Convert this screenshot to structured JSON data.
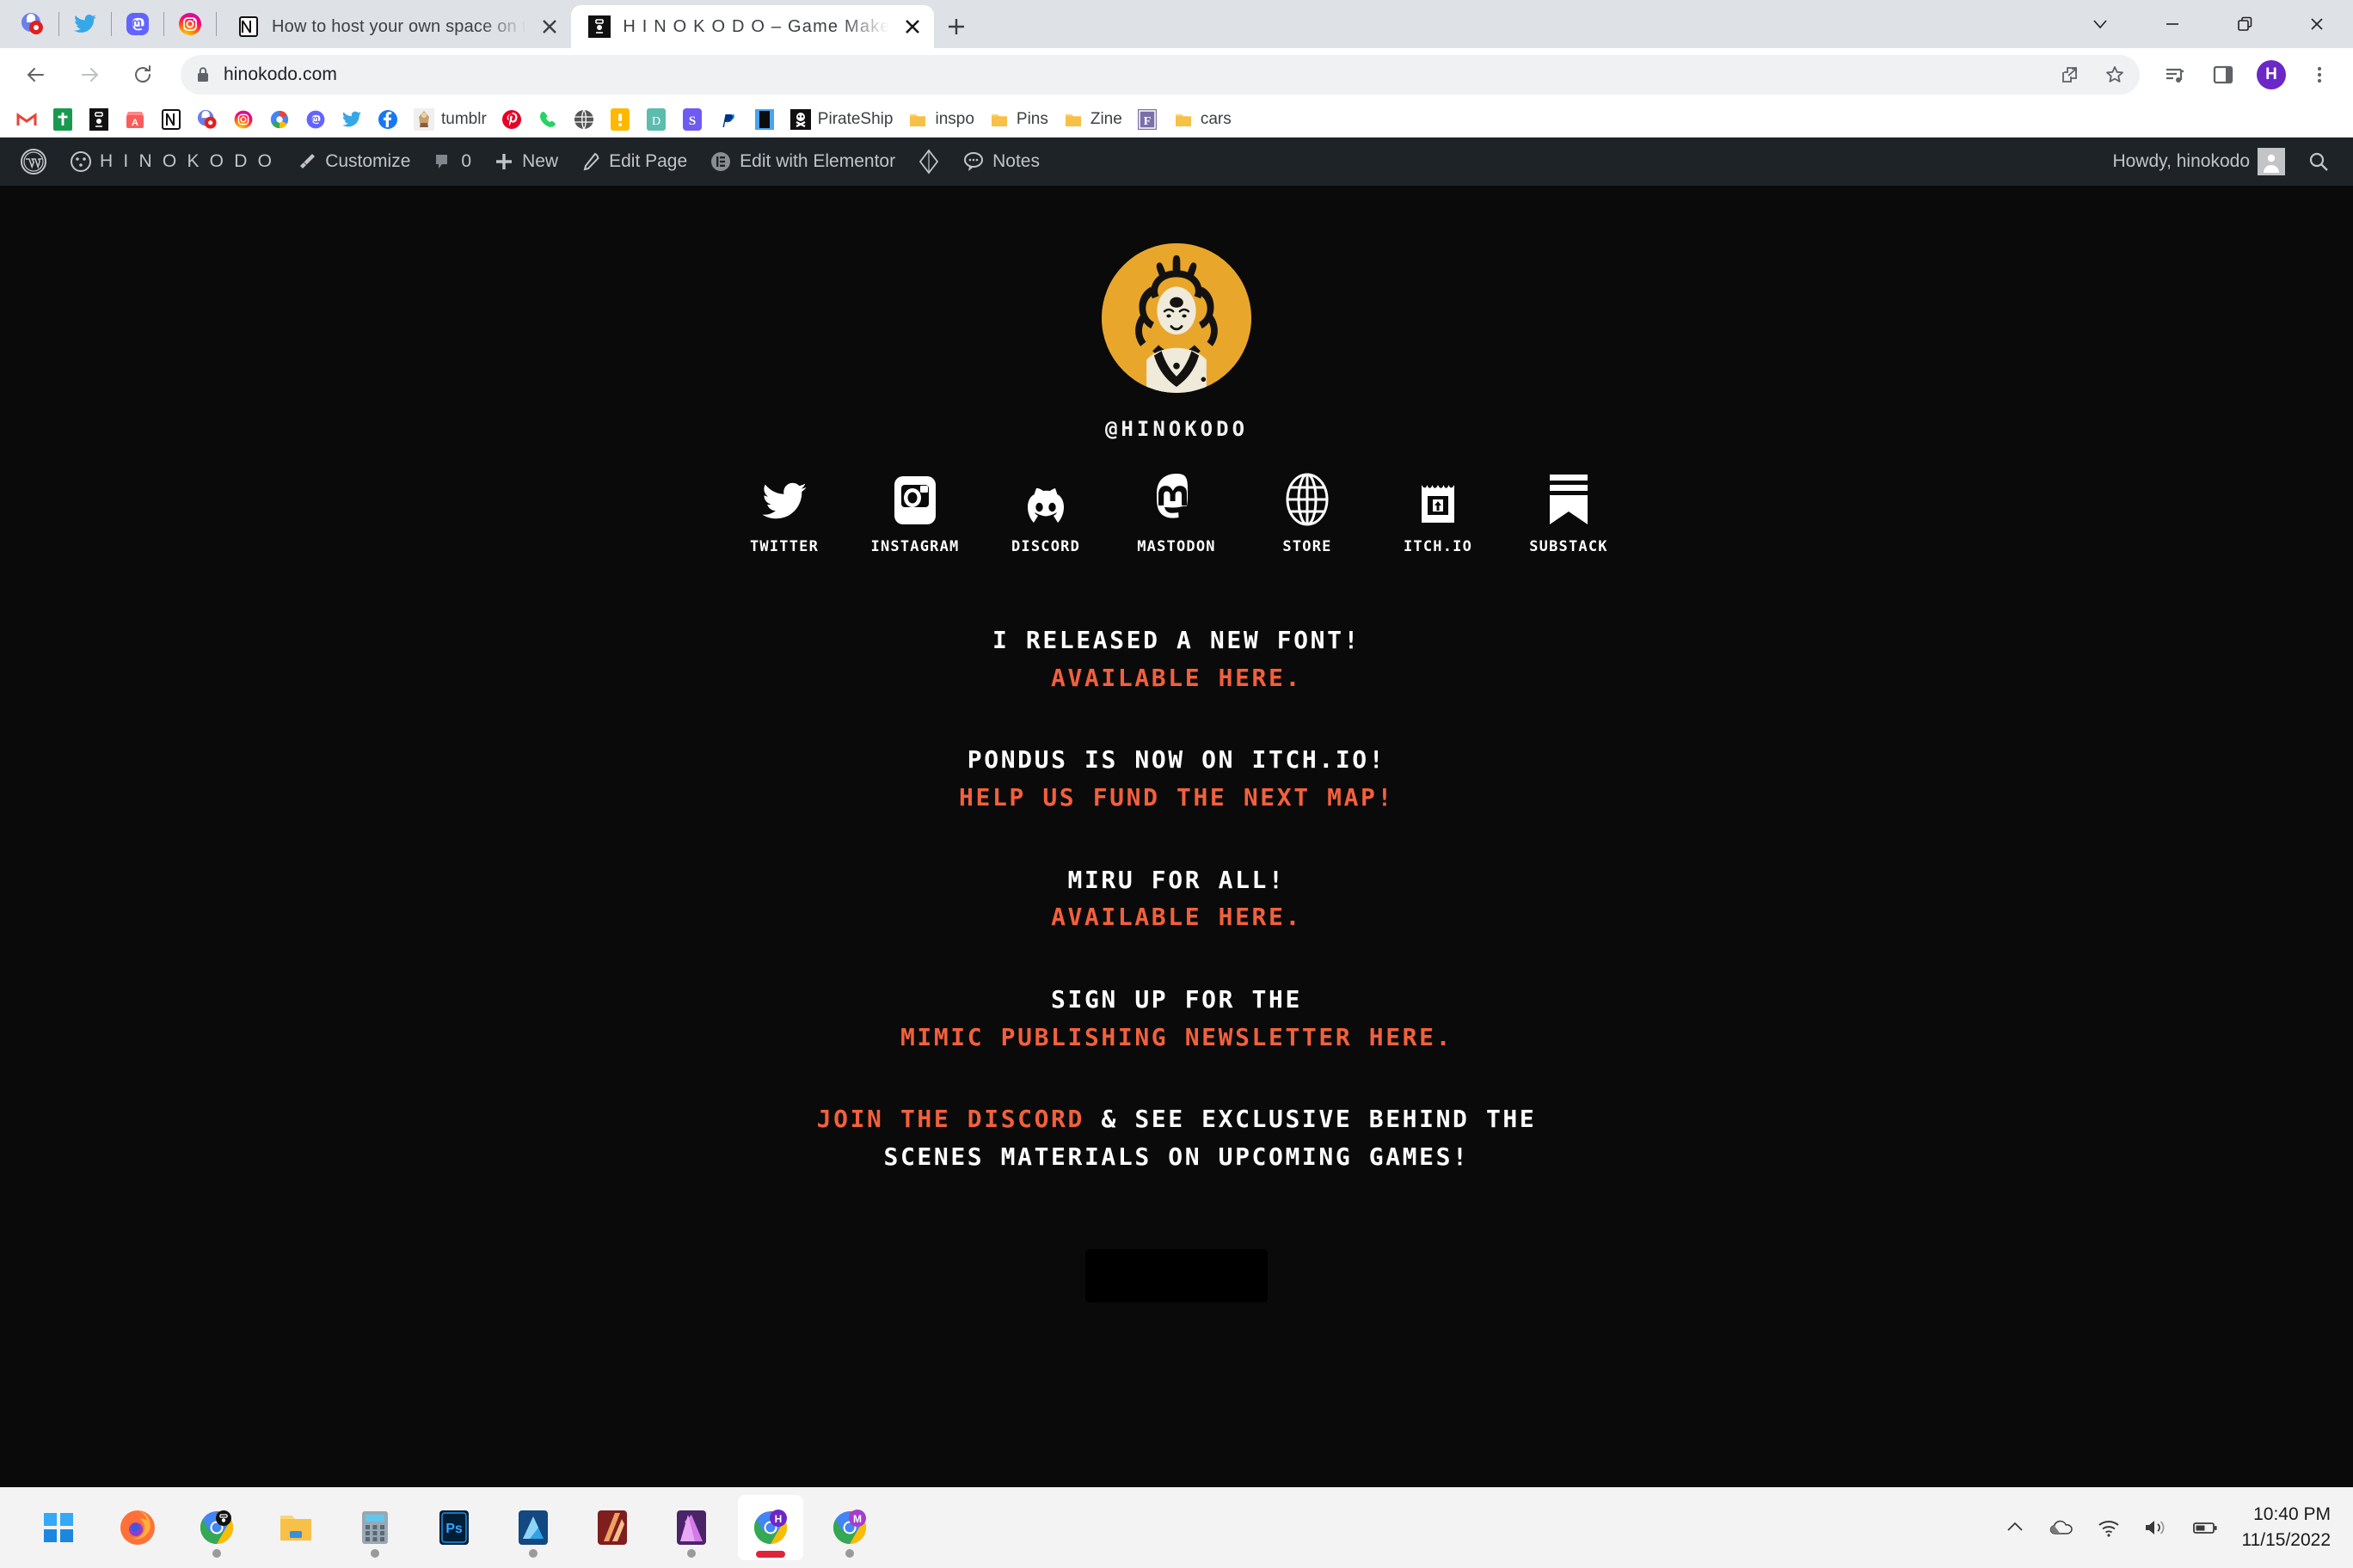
{
  "browser": {
    "pinned_tabs": [
      {
        "name": "google-photos-pinned-tab",
        "icon": "google-photos-icon"
      },
      {
        "name": "twitter-pinned-tab",
        "icon": "twitter-icon"
      },
      {
        "name": "mastodon-pinned-tab",
        "icon": "mastodon-icon"
      },
      {
        "name": "instagram-pinned-tab",
        "icon": "instagram-icon"
      }
    ],
    "tabs": [
      {
        "title": "How to host your own space on t",
        "favicon": "notion-icon",
        "active": false
      },
      {
        "title": "H I N O K O D O – Game Maker &",
        "favicon": "hinokodo-icon",
        "active": true
      }
    ],
    "new_tab_label": "+",
    "window_controls": {
      "minimize_to_tray": "v",
      "minimize": "—",
      "restore": "❐",
      "close": "✕"
    },
    "nav": {
      "back": "←",
      "forward": "→",
      "reload": "⟳"
    },
    "omnibox": {
      "url": "hinokodo.com",
      "lock_icon": "lock-icon",
      "share_icon": "share-icon",
      "bookmark_icon": "star-icon"
    },
    "toolbar_icons": [
      "media-control-icon",
      "side-panel-icon",
      "profile-avatar",
      "three-dot-menu-icon"
    ],
    "profile_initial": "H",
    "bookmarks": [
      {
        "label": "",
        "icon": "gmail-icon"
      },
      {
        "label": "",
        "icon": "bible-icon"
      },
      {
        "label": "",
        "icon": "hinokodo-icon"
      },
      {
        "label": "",
        "icon": "storefront-icon"
      },
      {
        "label": "",
        "icon": "notion-icon"
      },
      {
        "label": "",
        "icon": "google-photos-icon"
      },
      {
        "label": "",
        "icon": "instagram-icon"
      },
      {
        "label": "",
        "icon": "google-photos-alt-icon"
      },
      {
        "label": "",
        "icon": "mastodon-icon"
      },
      {
        "label": "",
        "icon": "twitter-icon"
      },
      {
        "label": "",
        "icon": "facebook-icon"
      },
      {
        "label": "tumblr",
        "icon": "tumblr-icon"
      },
      {
        "label": "",
        "icon": "pinterest-icon"
      },
      {
        "label": "",
        "icon": "phone-icon"
      },
      {
        "label": "",
        "icon": "globe-icon"
      },
      {
        "label": "",
        "icon": "yellow-app-icon"
      },
      {
        "label": "",
        "icon": "teal-d-icon"
      },
      {
        "label": "",
        "icon": "substack-s-icon"
      },
      {
        "label": "",
        "icon": "paypal-icon"
      },
      {
        "label": "",
        "icon": "blue-square-icon"
      },
      {
        "label": "PirateShip",
        "icon": "pirateship-icon"
      },
      {
        "label": "inspo",
        "icon": "folder-icon"
      },
      {
        "label": "Pins",
        "icon": "folder-icon"
      },
      {
        "label": "Zine",
        "icon": "folder-icon"
      },
      {
        "label": "",
        "icon": "figma-f-icon"
      },
      {
        "label": "cars",
        "icon": "folder-icon"
      }
    ]
  },
  "wp_admin_bar": {
    "logo": "wordpress-icon",
    "site_name": "H I N O K O D O",
    "items": [
      {
        "label": "Customize",
        "icon": "paintbrush-icon"
      },
      {
        "label": "0",
        "icon": "comment-bubble-icon"
      },
      {
        "label": "New",
        "icon": "plus-icon"
      },
      {
        "label": "Edit Page",
        "icon": "pencil-icon"
      },
      {
        "label": "Edit with Elementor",
        "icon": "elementor-icon"
      },
      {
        "label": "",
        "icon": "diamond-icon"
      },
      {
        "label": "Notes",
        "icon": "notes-bubble-icon"
      }
    ],
    "greeting": "Howdy, hinokodo",
    "avatar": "user-avatar",
    "search": "search-icon"
  },
  "site": {
    "avatar_alt": "hinokodo-illustrated-avatar",
    "avatar_bg": "#E8A72B",
    "handle": "@HINOKODO",
    "link_color": "#F2603C",
    "text_color": "#FFFFFF",
    "background": "#0A0A0A",
    "socials": [
      {
        "label": "TWITTER",
        "icon": "twitter-icon"
      },
      {
        "label": "INSTAGRAM",
        "icon": "instagram-icon"
      },
      {
        "label": "DISCORD",
        "icon": "discord-icon"
      },
      {
        "label": "MASTODON",
        "icon": "mastodon-icon"
      },
      {
        "label": "STORE",
        "icon": "globe-icon"
      },
      {
        "label": "ITCH.IO",
        "icon": "itchio-icon"
      },
      {
        "label": "SUBSTACK",
        "icon": "substack-icon"
      }
    ],
    "blocks": [
      {
        "lines": [
          {
            "text": "I RELEASED A NEW FONT!",
            "link": false
          },
          {
            "text": "AVAILABLE HERE.",
            "link": true
          }
        ]
      },
      {
        "lines": [
          {
            "text": "PONDUS IS NOW ON ITCH.IO!",
            "link": false
          },
          {
            "text": "HELP US FUND THE NEXT MAP!",
            "link": true
          }
        ]
      },
      {
        "lines": [
          {
            "text": "MIRU FOR ALL!",
            "link": false
          },
          {
            "text": "AVAILABLE HERE.",
            "link": true
          }
        ]
      },
      {
        "lines": [
          {
            "text": "SIGN UP FOR THE",
            "link": false
          },
          {
            "text": "MIMIC PUBLISHING NEWSLETTER HERE.",
            "link": true
          }
        ]
      }
    ],
    "discord_block": {
      "link_text": "JOIN THE DISCORD",
      "rest_text": " & SEE EXCLUSIVE BEHIND THE",
      "line2": "SCENES MATERIALS ON UPCOMING GAMES!"
    }
  },
  "taskbar": {
    "apps": [
      {
        "name": "start-button",
        "icon": "windows-logo",
        "running": false,
        "active": false
      },
      {
        "name": "firefox",
        "icon": "firefox-icon",
        "running": false,
        "active": false
      },
      {
        "name": "chrome-hinokodo",
        "icon": "chrome-hinokodo-icon",
        "running": true,
        "active": false
      },
      {
        "name": "file-explorer",
        "icon": "folder-icon",
        "running": false,
        "active": false
      },
      {
        "name": "calculator",
        "icon": "calculator-icon",
        "running": true,
        "active": false
      },
      {
        "name": "photoshop",
        "icon": "photoshop-icon",
        "running": false,
        "active": false
      },
      {
        "name": "affinity-designer",
        "icon": "affinity-designer-icon",
        "running": true,
        "active": false
      },
      {
        "name": "affinity-photo",
        "icon": "affinity-photo-icon",
        "running": false,
        "active": false
      },
      {
        "name": "affinity-publisher",
        "icon": "affinity-publisher-icon",
        "running": true,
        "active": false
      },
      {
        "name": "chrome-profile-h",
        "icon": "chrome-profile-h-icon",
        "running": true,
        "active": true
      },
      {
        "name": "chrome-profile-m",
        "icon": "chrome-profile-m-icon",
        "running": true,
        "active": false
      }
    ],
    "tray": [
      "show-hidden-icons-chevron",
      "onedrive-icon",
      "wifi-icon",
      "volume-icon",
      "battery-icon"
    ],
    "time": "10:40 PM",
    "date": "11/15/2022"
  }
}
